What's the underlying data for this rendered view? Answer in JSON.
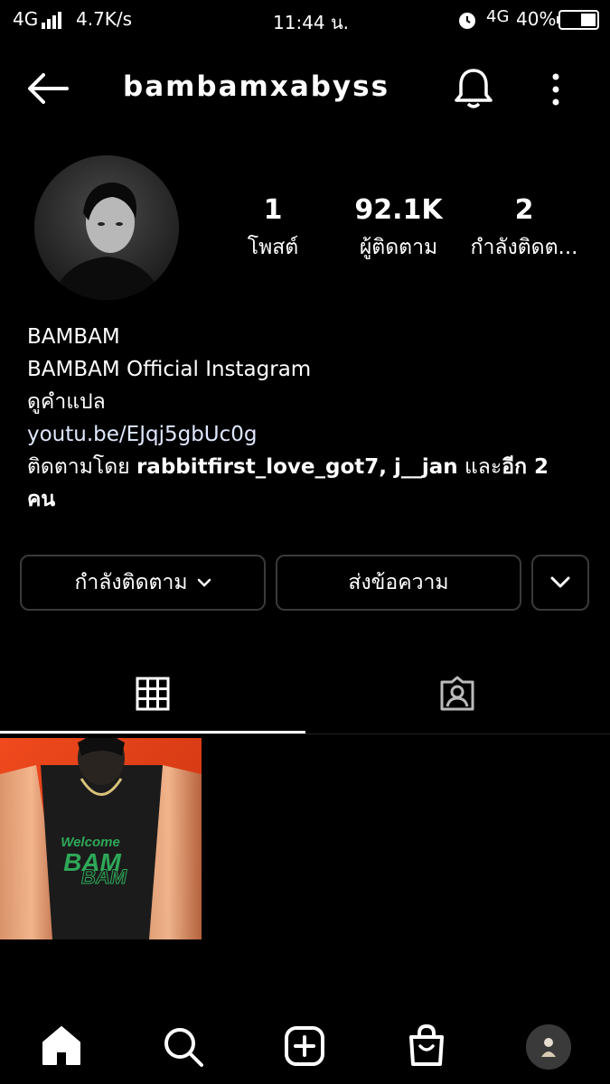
{
  "status_bar": {
    "network": "4G",
    "speed": "4.7K/s",
    "time": "11:44 น.",
    "network_right": "4G",
    "battery": "40%"
  },
  "header": {
    "username": "bambamxabyss"
  },
  "profile": {
    "stats": [
      {
        "value": "1",
        "label": "โพสต์"
      },
      {
        "value": "92.1K",
        "label": "ผู้ติดตาม"
      },
      {
        "value": "2",
        "label": "กำลังติดต..."
      }
    ],
    "name": "BAMBAM",
    "bio_line": "BAMBAM Official Instagram",
    "translate": "ดูคำแปล",
    "link": "youtu.be/EJqj5gbUc0g",
    "followed_by_prefix": "ติดตามโดย ",
    "followed_by_users": "rabbitfirst_love_got7, j__jan",
    "followed_by_mid": " และ",
    "followed_by_more": "อีก 2 คน"
  },
  "buttons": {
    "following": "กำลังติดตาม",
    "message": "ส่งข้อความ"
  },
  "post": {
    "caption_top": "Welcome",
    "caption_main": "BAM",
    "caption_sub": "BAM"
  },
  "colors": {
    "background": "#000000",
    "button_border": "#3a3a3a",
    "post_orange": "#e0421a"
  },
  "icons": [
    "back-arrow-icon",
    "bell-icon",
    "more-vertical-icon",
    "chevron-down-icon",
    "grid-icon",
    "tagged-icon",
    "home-icon",
    "search-icon",
    "new-post-icon",
    "shop-icon"
  ]
}
